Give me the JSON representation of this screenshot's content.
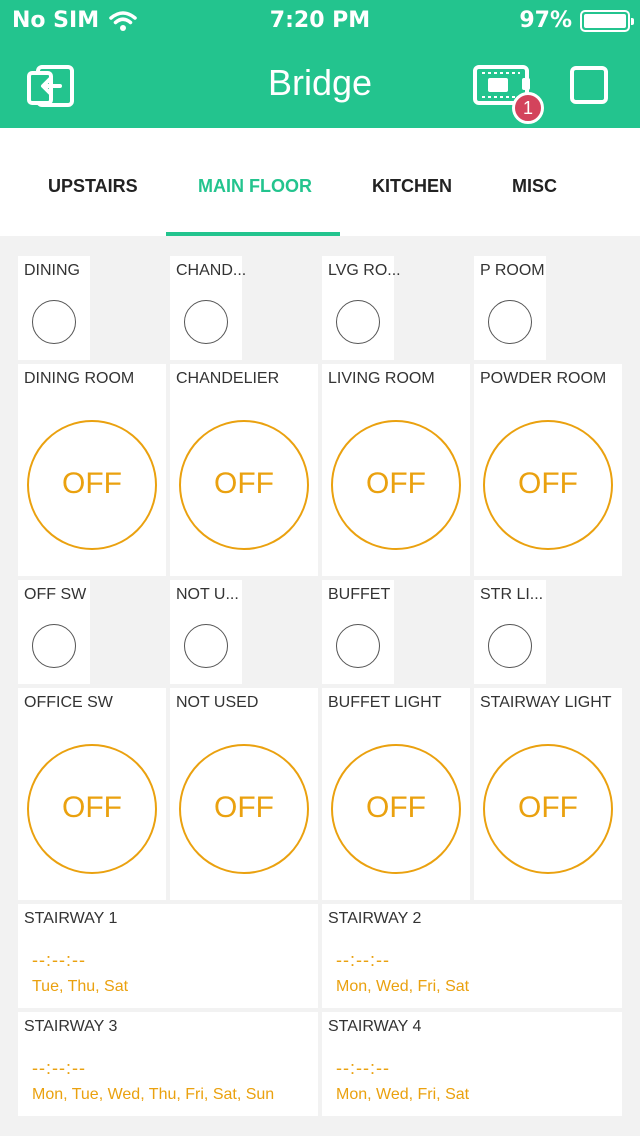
{
  "status_bar": {
    "carrier": "No SIM",
    "time": "7:20 PM",
    "battery": "97%"
  },
  "header": {
    "title": "Bridge",
    "badge_count": "1"
  },
  "tabs": [
    {
      "label": "UPSTAIRS"
    },
    {
      "label": "MAIN FLOOR"
    },
    {
      "label": "KITCHEN"
    },
    {
      "label": "MISC"
    }
  ],
  "leds": [
    {
      "label": "DINING"
    },
    {
      "label": "CHAND..."
    },
    {
      "label": "LVG RO..."
    },
    {
      "label": "P ROOM"
    },
    {
      "label": "OFF SW"
    },
    {
      "label": "NOT U..."
    },
    {
      "label": "BUFFET"
    },
    {
      "label": "STR LI..."
    }
  ],
  "buttons": [
    {
      "label": "DINING ROOM",
      "state": "OFF"
    },
    {
      "label": "CHANDELIER",
      "state": "OFF"
    },
    {
      "label": "LIVING ROOM",
      "state": "OFF"
    },
    {
      "label": "POWDER ROOM",
      "state": "OFF"
    },
    {
      "label": "OFFICE SW",
      "state": "OFF"
    },
    {
      "label": "NOT USED",
      "state": "OFF"
    },
    {
      "label": "BUFFET LIGHT",
      "state": "OFF"
    },
    {
      "label": "STAIRWAY LIGHT",
      "state": "OFF"
    }
  ],
  "timers": [
    {
      "label": "STAIRWAY 1",
      "time": "--:--:--",
      "days": "Tue, Thu, Sat"
    },
    {
      "label": "STAIRWAY 2",
      "time": "--:--:--",
      "days": "Mon, Wed, Fri, Sat"
    },
    {
      "label": "STAIRWAY 3",
      "time": "--:--:--",
      "days": "Mon, Tue, Wed, Thu, Fri, Sat, Sun"
    },
    {
      "label": "STAIRWAY 4",
      "time": "--:--:--",
      "days": "Mon, Wed, Fri, Sat"
    }
  ],
  "colors": {
    "brand": "#23c48e",
    "accent": "#eaa10f",
    "badge": "#d3435c"
  },
  "icons": {
    "back": "exit-project-icon",
    "board": "device-board-icon",
    "stop": "stop-square-icon"
  }
}
